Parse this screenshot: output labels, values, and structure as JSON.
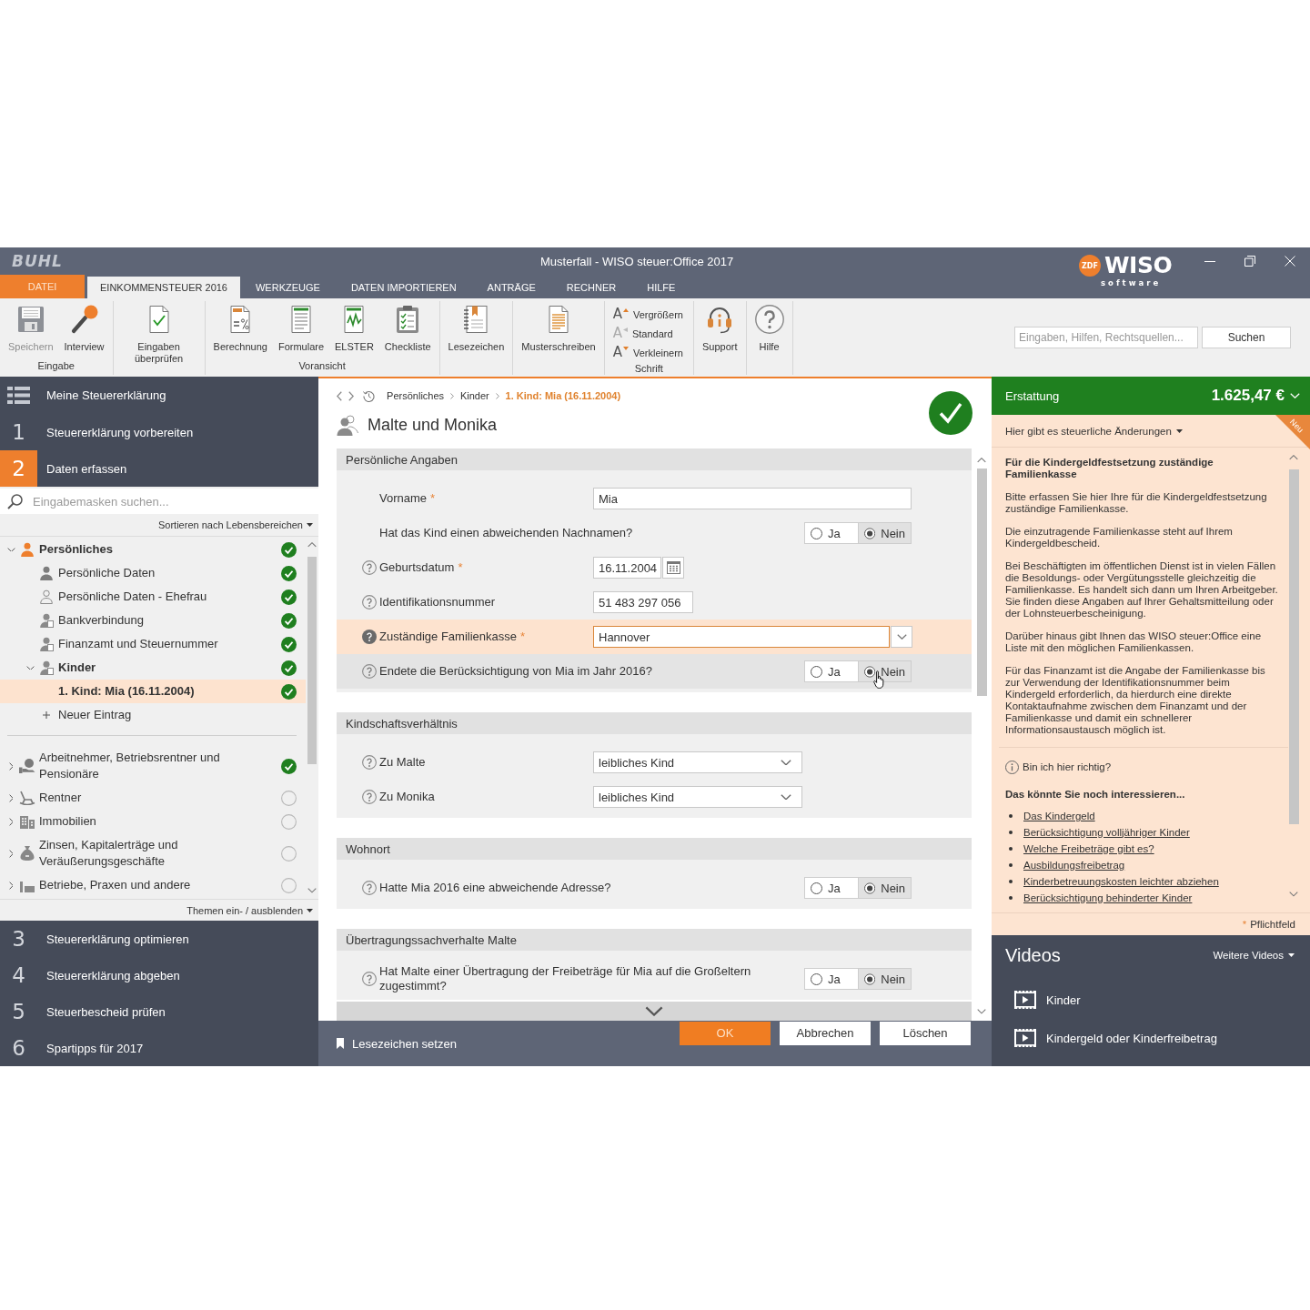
{
  "window": {
    "logo": "BUHL",
    "title": "Musterfall - WISO steuer:Office 2017",
    "brand": {
      "badge": "ZDF",
      "name": "WISO",
      "tagline": "software"
    }
  },
  "menu_tabs": [
    {
      "label": "DATEI",
      "kind": "file",
      "selected": false
    },
    {
      "label": "EINKOMMENSTEUER 2016",
      "kind": "tab",
      "selected": true
    },
    {
      "label": "WERKZEUGE",
      "kind": "tab",
      "selected": false
    },
    {
      "label": "DATEN IMPORTIEREN",
      "kind": "tab",
      "selected": false
    },
    {
      "label": "ANTRÄGE",
      "kind": "tab",
      "selected": false
    },
    {
      "label": "RECHNER",
      "kind": "tab",
      "selected": false
    },
    {
      "label": "HILFE",
      "kind": "tab",
      "selected": false
    }
  ],
  "ribbon": {
    "groups": [
      {
        "label": "Eingabe",
        "items": [
          {
            "kind": "large",
            "label": "Speichern",
            "disabled": true
          },
          {
            "kind": "large",
            "label": "Interview",
            "disabled": false
          }
        ]
      },
      {
        "items": [
          {
            "kind": "large",
            "label": "Eingaben überprüfen",
            "disabled": false
          }
        ]
      },
      {
        "label": "Voransicht",
        "items": [
          {
            "kind": "large",
            "label": "Berechnung",
            "disabled": false
          },
          {
            "kind": "large",
            "label": "Formulare",
            "disabled": false
          },
          {
            "kind": "large",
            "label": "ELSTER",
            "disabled": false
          },
          {
            "kind": "large",
            "label": "Checkliste",
            "disabled": false
          }
        ]
      },
      {
        "items": [
          {
            "kind": "large",
            "label": "Lesezeichen",
            "disabled": false
          }
        ]
      },
      {
        "items": [
          {
            "kind": "large",
            "label": "Musterschreiben",
            "disabled": false
          }
        ]
      },
      {
        "label": "Schrift",
        "items": [
          {
            "kind": "small",
            "glyph": "A",
            "label": "Vergrößern",
            "disabled": false
          },
          {
            "kind": "small",
            "glyph": "A",
            "label": "Standard",
            "disabled": true
          },
          {
            "kind": "small",
            "glyph": "A",
            "label": "Verkleinern",
            "disabled": false
          }
        ]
      },
      {
        "items": [
          {
            "kind": "large",
            "label": "Support",
            "disabled": false
          }
        ]
      },
      {
        "items": [
          {
            "kind": "large",
            "label": "Hilfe",
            "disabled": false
          }
        ]
      }
    ],
    "search": {
      "placeholder": "Eingaben, Hilfen, Rechtsquellen..."
    },
    "search_button": "Suchen"
  },
  "sidebar": {
    "header": "Meine Steuererklärung",
    "steps": [
      {
        "number": "1",
        "label": "Steuererklärung vorbereiten",
        "selected": false
      },
      {
        "number": "2",
        "label": "Daten erfassen",
        "selected": true
      },
      {
        "number": "3",
        "label": "Steuererklärung optimieren",
        "selected": false
      },
      {
        "number": "4",
        "label": "Steuererklärung abgeben",
        "selected": false
      },
      {
        "number": "5",
        "label": "Steuerbescheid prüfen",
        "selected": false
      },
      {
        "number": "6",
        "label": "Spartipps für 2017",
        "selected": false
      }
    ],
    "search": {
      "placeholder": "Eingabemasken suchen..."
    },
    "sort_menu": "Sortieren nach Lebensbereichen",
    "tree": [
      {
        "label": "Persönliches",
        "done": true,
        "expanded": true,
        "selected": false,
        "children": [
          {
            "label": "Persönliche Daten",
            "done": true,
            "selected": false
          },
          {
            "label": "Persönliche Daten - Ehefrau",
            "done": true,
            "selected": false
          },
          {
            "label": "Bankverbindung",
            "done": true,
            "selected": false
          },
          {
            "label": "Finanzamt und Steuernummer",
            "done": true,
            "selected": false
          },
          {
            "label": "Kinder",
            "done": true,
            "expanded": true,
            "selected": false,
            "children": [
              {
                "label": "1. Kind: Mia (16.11.2004)",
                "done": true,
                "selected": true
              },
              {
                "kind": "add",
                "label": "Neuer Eintrag",
                "selected": false
              }
            ]
          }
        ]
      },
      {
        "label": "Arbeitnehmer, Betriebsrentner und Pensionäre",
        "done": true,
        "expanded": false,
        "selected": false
      },
      {
        "label": "Rentner",
        "done": false,
        "expanded": false,
        "selected": false
      },
      {
        "label": "Immobilien",
        "done": false,
        "expanded": false,
        "selected": false
      },
      {
        "label": "Zinsen, Kapitalerträge und Veräußerungsgeschäfte",
        "done": false,
        "expanded": false,
        "selected": false
      },
      {
        "label": "Betriebe, Praxen und andere",
        "done": false,
        "expanded": false,
        "selected": false
      }
    ],
    "toggle_menu": "Themen ein- / ausblenden"
  },
  "form": {
    "breadcrumb": [
      {
        "label": "Persönliches",
        "selected": false
      },
      {
        "label": "Kinder",
        "selected": false
      },
      {
        "label": "1. Kind: Mia (16.11.2004)",
        "selected": true
      }
    ],
    "complete": true,
    "title": "Malte und Monika",
    "sections": [
      {
        "title": "Persönliche Angaben",
        "rows": [
          {
            "kind": "text",
            "label": "Vorname",
            "required_mark": "*",
            "help": false,
            "focused": false,
            "hovered": false,
            "value": "Mia"
          },
          {
            "kind": "radio",
            "label": "Hat das Kind einen abweichenden Nachnamen?",
            "help": false,
            "focused": false,
            "hovered": false,
            "options": [
              {
                "label": "Ja",
                "selected": false
              },
              {
                "label": "Nein",
                "selected": true
              }
            ]
          },
          {
            "kind": "date",
            "label": "Geburtsdatum",
            "required_mark": "*",
            "help": true,
            "focused": false,
            "hovered": false,
            "value": "16.11.2004"
          },
          {
            "kind": "number",
            "label": "Identifikationsnummer",
            "help": true,
            "focused": false,
            "hovered": false,
            "value": "51 483 297 056"
          },
          {
            "kind": "combo",
            "label": "Zuständige Familienkasse",
            "required_mark": "*",
            "help": true,
            "focused": true,
            "hovered": false,
            "value": "Hannover"
          },
          {
            "kind": "radio",
            "label": "Endete die Berücksichtigung von Mia im Jahr 2016?",
            "help": true,
            "focused": false,
            "hovered": true,
            "options": [
              {
                "label": "Ja",
                "selected": false
              },
              {
                "label": "Nein",
                "selected": true
              }
            ]
          }
        ]
      },
      {
        "title": "Kindschaftsverhältnis",
        "rows": [
          {
            "kind": "select",
            "label": "Zu Malte",
            "help": true,
            "focused": false,
            "hovered": false,
            "value": "leibliches Kind"
          },
          {
            "kind": "select",
            "label": "Zu Monika",
            "help": true,
            "focused": false,
            "hovered": false,
            "value": "leibliches Kind"
          }
        ]
      },
      {
        "title": "Wohnort",
        "rows": [
          {
            "kind": "radio",
            "label": "Hatte Mia 2016 eine abweichende Adresse?",
            "help": true,
            "focused": false,
            "hovered": false,
            "options": [
              {
                "label": "Ja",
                "selected": false
              },
              {
                "label": "Nein",
                "selected": true
              }
            ]
          }
        ]
      },
      {
        "title": "Übertragungssachverhalte Malte",
        "rows": [
          {
            "kind": "radio",
            "label": "Hat Malte einer Übertragung der Freibeträge für Mia auf die Großeltern zugestimmt?",
            "help": true,
            "focused": false,
            "hovered": false,
            "options": [
              {
                "label": "Ja",
                "selected": false
              },
              {
                "label": "Nein",
                "selected": true
              }
            ]
          }
        ]
      }
    ],
    "bookmark": "Lesezeichen setzen",
    "buttons": [
      {
        "label": "OK",
        "kind": "primary"
      },
      {
        "label": "Abbrechen",
        "kind": "secondary"
      },
      {
        "label": "Löschen",
        "kind": "secondary"
      }
    ]
  },
  "refund": {
    "label": "Erstattung",
    "amount": "1.625,47 €"
  },
  "info": {
    "changes_menu": "Hier gibt es steuerliche Änderungen",
    "badge": "Neu",
    "title": "Für die Kindergeldfestsetzung zuständige Familienkasse",
    "paragraphs": [
      "Bitte erfassen Sie hier Ihre für die Kindergeldfestsetzung zuständige Familienkasse.",
      "Die einzutragende Familienkasse steht auf Ihrem Kindergeldbescheid.",
      "Bei Beschäftigten im öffentlichen Dienst ist in vielen Fällen die Besoldungs- oder Vergütungsstelle gleichzeitig die Familienkasse. Es handelt sich dann um Ihren Arbeitgeber. Sie finden diese Angaben auf Ihrer Gehaltsmitteilung oder der Lohnsteuerbescheinigung.",
      "Darüber hinaus gibt Ihnen das WISO steuer:Office eine Liste mit den möglichen Familienkassen.",
      "Für das Finanzamt ist die Angabe der Familienkasse bis zur Verwendung der Identifikationsnummer beim Kindergeld erforderlich, da hierdurch eine direkte Kontaktaufnahme zwischen dem Finanzamt und der Familienkasse und damit ein schnellerer Informationsaustausch möglich ist."
    ],
    "help_link": "Bin ich hier richtig?",
    "related_title": "Das könnte Sie noch interessieren...",
    "related_links": [
      "Das Kindergeld",
      "Berücksichtigung volljähriger Kinder",
      "Welche Freibeträge gibt es?",
      "Ausbildungsfreibetrag",
      "Kinderbetreuungskosten leichter abziehen",
      "Berücksichtigung behinderter Kinder"
    ],
    "required_note": {
      "mark": "*",
      "label": "Pflichtfeld"
    }
  },
  "videos": {
    "title": "Videos",
    "more_menu": "Weitere Videos",
    "items": [
      {
        "label": "Kinder"
      },
      {
        "label": "Kindergeld oder Kinderfreibetrag"
      }
    ]
  }
}
